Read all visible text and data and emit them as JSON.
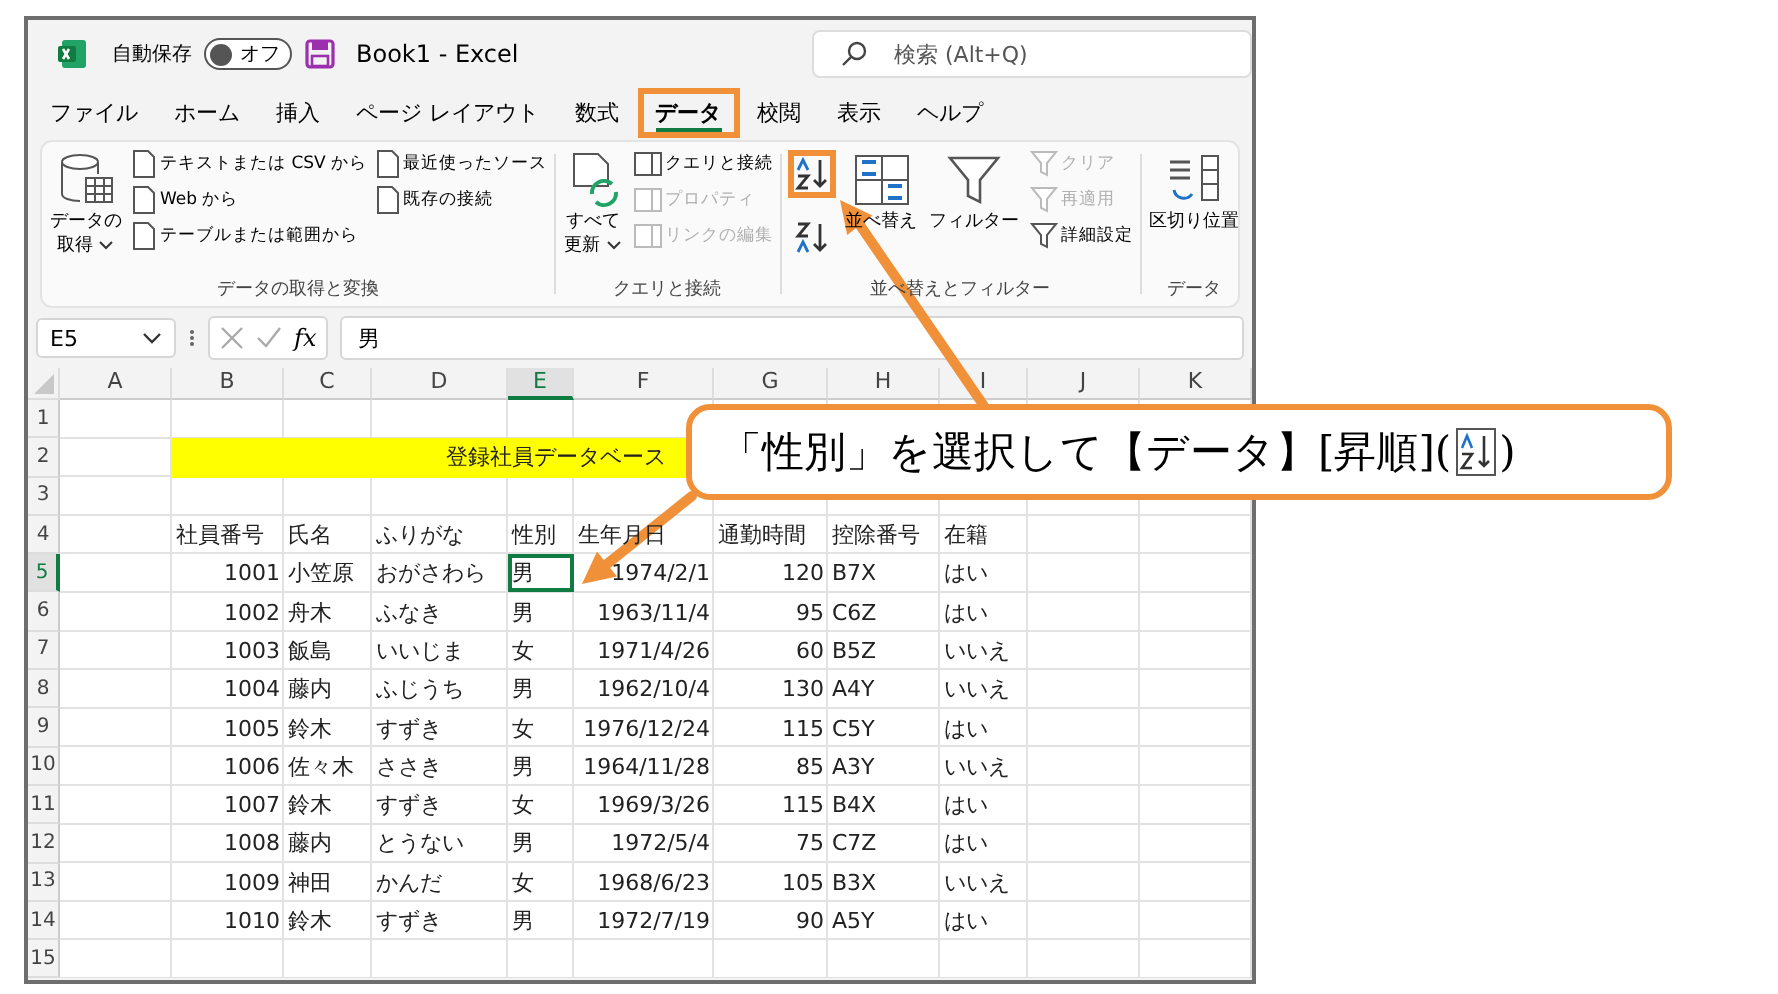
{
  "title_bar": {
    "autosave_label": "自動保存",
    "autosave": {
      "on": false,
      "label": "オフ"
    },
    "document_title": "Book1  -  Excel",
    "search": {
      "placeholder": "検索 (Alt+Q)"
    }
  },
  "menu_tabs": [
    {
      "label": "ファイル",
      "selected": false,
      "highlighted": false
    },
    {
      "label": "ホーム",
      "selected": false,
      "highlighted": false
    },
    {
      "label": "挿入",
      "selected": false,
      "highlighted": false
    },
    {
      "label": "ページ レイアウト",
      "selected": false,
      "highlighted": false
    },
    {
      "label": "数式",
      "selected": false,
      "highlighted": false
    },
    {
      "label": "データ",
      "selected": true,
      "highlighted": true
    },
    {
      "label": "校閲",
      "selected": false,
      "highlighted": false
    },
    {
      "label": "表示",
      "selected": false,
      "highlighted": false
    },
    {
      "label": "ヘルプ",
      "selected": false,
      "highlighted": false
    }
  ],
  "ribbon": {
    "get_transform": {
      "label": "データの取得と変換",
      "get_data": [
        "データの",
        "取得"
      ],
      "items": [
        {
          "label": "テキストまたは CSV から"
        },
        {
          "label": "Web から"
        },
        {
          "label": "テーブルまたは範囲から"
        },
        {
          "label": "最近使ったソース"
        },
        {
          "label": "既存の接続"
        }
      ]
    },
    "queries": {
      "label": "クエリと接続",
      "refresh_all": [
        "すべて",
        "更新"
      ],
      "items": [
        {
          "label": "クエリと接続",
          "disabled": false
        },
        {
          "label": "プロパティ",
          "disabled": true
        },
        {
          "label": "リンクの編集",
          "disabled": true
        }
      ]
    },
    "sort_filter": {
      "label": "並べ替えとフィルター",
      "sort_ascending": {
        "highlighted": true
      },
      "sort": "並べ替え",
      "filter": "フィルター",
      "items": [
        {
          "label": "クリア",
          "disabled": true
        },
        {
          "label": "再適用",
          "disabled": true
        },
        {
          "label": "詳細設定",
          "disabled": false
        }
      ]
    },
    "data_tools": {
      "label": "データ",
      "text_to_columns": "区切り位置"
    }
  },
  "formula_bar": {
    "name_box": "E5",
    "function_label": "fx",
    "formula": "男"
  },
  "sheet": {
    "columns": [
      {
        "label": "A",
        "selected": false
      },
      {
        "label": "B",
        "selected": false
      },
      {
        "label": "C",
        "selected": false
      },
      {
        "label": "D",
        "selected": false
      },
      {
        "label": "E",
        "selected": true
      },
      {
        "label": "F",
        "selected": false
      },
      {
        "label": "G",
        "selected": false
      },
      {
        "label": "H",
        "selected": false
      },
      {
        "label": "I",
        "selected": false
      },
      {
        "label": "J",
        "selected": false
      },
      {
        "label": "K",
        "selected": false
      }
    ],
    "rows": [
      {
        "number": "1",
        "kind": "blank",
        "selected": false
      },
      {
        "number": "2",
        "kind": "title",
        "selected": false,
        "text": "登録社員データベース"
      },
      {
        "number": "3",
        "kind": "blank",
        "selected": false
      },
      {
        "number": "4",
        "kind": "header",
        "selected": false,
        "cells": [
          "社員番号",
          "氏名",
          "ふりがな",
          "性別",
          "生年月日",
          "通勤時間",
          "控除番号",
          "在籍"
        ]
      },
      {
        "number": "5",
        "kind": "record",
        "selected": true,
        "cells": [
          "1001",
          "小笠原",
          "おがさわら",
          "男",
          "1974/2/1",
          "120",
          "B7X",
          "はい"
        ]
      },
      {
        "number": "6",
        "kind": "record",
        "selected": false,
        "cells": [
          "1002",
          "舟木",
          "ふなき",
          "男",
          "1963/11/4",
          "95",
          "C6Z",
          "はい"
        ]
      },
      {
        "number": "7",
        "kind": "record",
        "selected": false,
        "cells": [
          "1003",
          "飯島",
          "いいじま",
          "女",
          "1971/4/26",
          "60",
          "B5Z",
          "いいえ"
        ]
      },
      {
        "number": "8",
        "kind": "record",
        "selected": false,
        "cells": [
          "1004",
          "藤内",
          "ふじうち",
          "男",
          "1962/10/4",
          "130",
          "A4Y",
          "いいえ"
        ]
      },
      {
        "number": "9",
        "kind": "record",
        "selected": false,
        "cells": [
          "1005",
          "鈴木",
          "すずき",
          "女",
          "1976/12/24",
          "115",
          "C5Y",
          "はい"
        ]
      },
      {
        "number": "10",
        "kind": "record",
        "selected": false,
        "cells": [
          "1006",
          "佐々木",
          "ささき",
          "男",
          "1964/11/28",
          "85",
          "A3Y",
          "いいえ"
        ]
      },
      {
        "number": "11",
        "kind": "record",
        "selected": false,
        "cells": [
          "1007",
          "鈴木",
          "すずき",
          "女",
          "1969/3/26",
          "115",
          "B4X",
          "はい"
        ]
      },
      {
        "number": "12",
        "kind": "record",
        "selected": false,
        "cells": [
          "1008",
          "藤内",
          "とうない",
          "男",
          "1972/5/4",
          "75",
          "C7Z",
          "はい"
        ]
      },
      {
        "number": "13",
        "kind": "record",
        "selected": false,
        "cells": [
          "1009",
          "神田",
          "かんだ",
          "女",
          "1968/6/23",
          "105",
          "B3X",
          "いいえ"
        ]
      },
      {
        "number": "14",
        "kind": "record",
        "selected": false,
        "cells": [
          "1010",
          "鈴木",
          "すずき",
          "男",
          "1972/7/19",
          "90",
          "A5Y",
          "はい"
        ]
      },
      {
        "number": "15",
        "kind": "blank",
        "selected": false
      }
    ]
  },
  "callout": {
    "text": "「性別」を選択して【データ】[昇順](",
    "closing": ")"
  }
}
